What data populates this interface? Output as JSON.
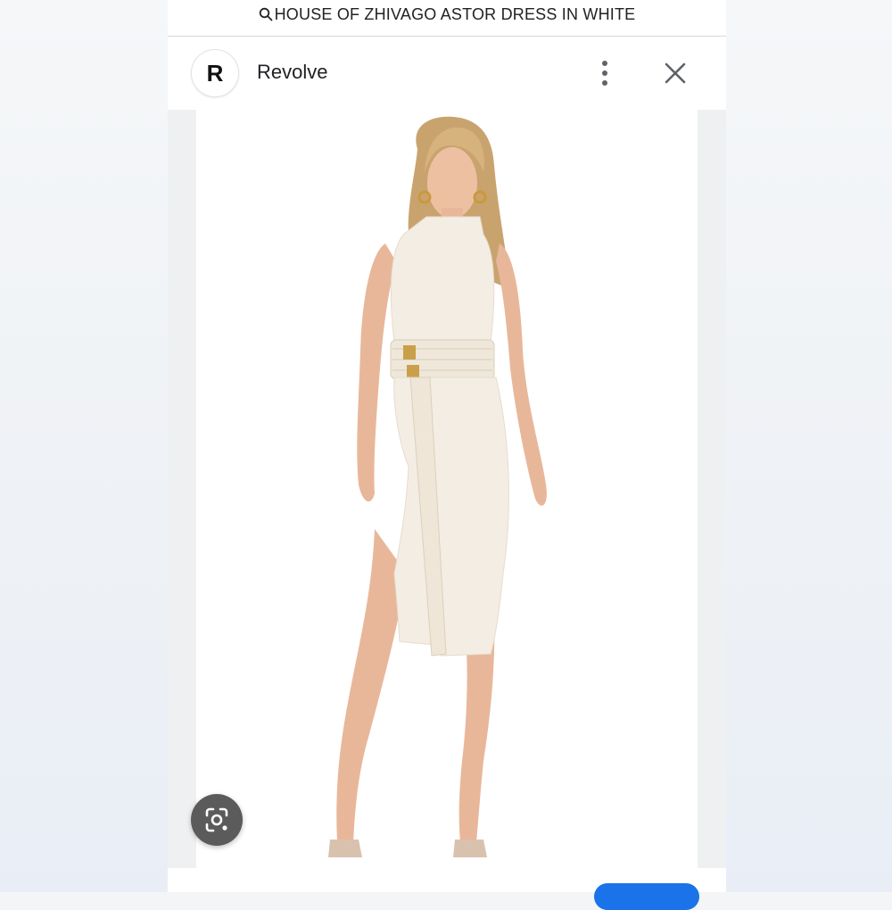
{
  "search": {
    "query": "HOUSE OF ZHIVAGO ASTOR DRESS IN WHITE",
    "icon": "search-icon"
  },
  "header": {
    "favicon_letter": "R",
    "site_name": "Revolve"
  },
  "colors": {
    "accent": "#1a73e8",
    "lens_button": "#5b5b5b",
    "dress": "#f4ede3",
    "skin": "#e8b79a"
  }
}
